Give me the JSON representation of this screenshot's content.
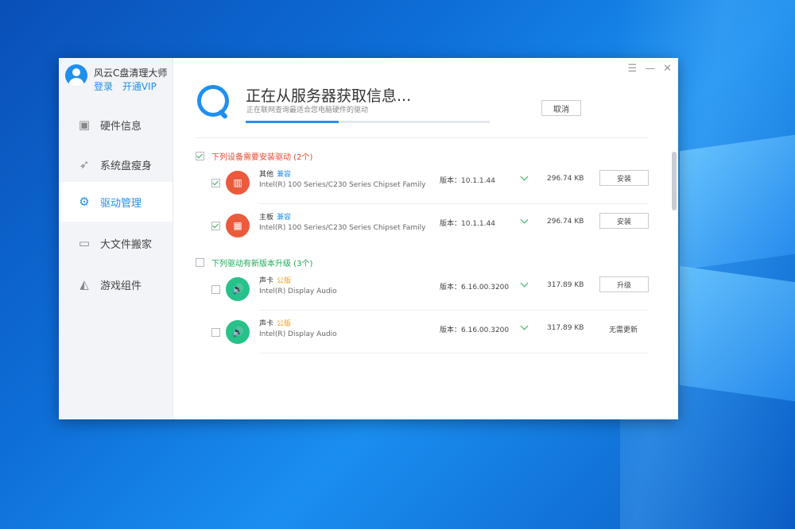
{
  "app": {
    "title": "风云C盘清理大师",
    "login": "登录",
    "vip": "开通VIP"
  },
  "nav": [
    {
      "label": "硬件信息",
      "icon": "hardware-icon",
      "active": false
    },
    {
      "label": "系统盘瘦身",
      "icon": "rocket-icon",
      "active": false
    },
    {
      "label": "驱动管理",
      "icon": "gear-icon",
      "active": true
    },
    {
      "label": "大文件搬家",
      "icon": "monitor-icon",
      "active": false
    },
    {
      "label": "游戏组件",
      "icon": "game-icon",
      "active": false
    }
  ],
  "status": {
    "title": "正在从服务器获取信息...",
    "subtitle": "正在联网查询最适合您电脑硬件的驱动",
    "progress": 0.38,
    "cancel": "取消"
  },
  "sections": [
    {
      "title": "下列设备需要安装驱动 (2个)",
      "checked": true,
      "items": [
        {
          "name": "其他",
          "tag": "兼容",
          "desc": "Intel(R) 100 Series/C230 Series Chipset Family",
          "version": "版本：10.1.1.44",
          "size": "296.74 KB",
          "action": "安装",
          "checked": true
        },
        {
          "name": "主板",
          "tag": "兼容",
          "desc": "Intel(R) 100 Series/C230 Series Chipset Family",
          "version": "版本：10.1.1.44",
          "size": "296.74 KB",
          "action": "安装",
          "checked": true
        }
      ]
    },
    {
      "title": "下列驱动有新版本升级 (3个)",
      "checked": false,
      "items": [
        {
          "name": "声卡",
          "tag": "公版",
          "desc": "Intel(R) Display Audio",
          "version": "版本：6.16.00.3200",
          "size": "317.89 KB",
          "action": "升级",
          "checked": false
        },
        {
          "name": "声卡",
          "tag": "公版",
          "desc": "Intel(R) Display Audio",
          "version": "版本：6.16.00.3200",
          "size": "317.89 KB",
          "action": "无需更新",
          "checked": false
        }
      ]
    }
  ],
  "window_controls": {
    "menu": "☰",
    "minimize": "—",
    "close": "✕"
  }
}
